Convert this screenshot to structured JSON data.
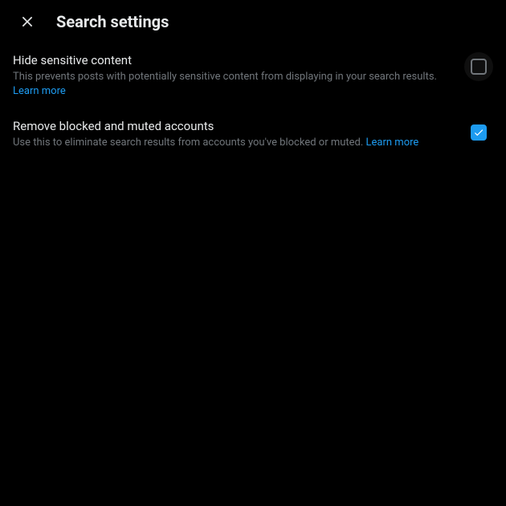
{
  "header": {
    "title": "Search settings"
  },
  "settings": {
    "hide_sensitive": {
      "title": "Hide sensitive content",
      "description": "This prevents posts with potentially sensitive content from displaying in your search results. ",
      "learn_more": "Learn more",
      "checked": false
    },
    "remove_blocked": {
      "title": "Remove blocked and muted accounts",
      "description": "Use this to eliminate search results from accounts you've blocked or muted. ",
      "learn_more": "Learn more",
      "checked": true
    }
  }
}
